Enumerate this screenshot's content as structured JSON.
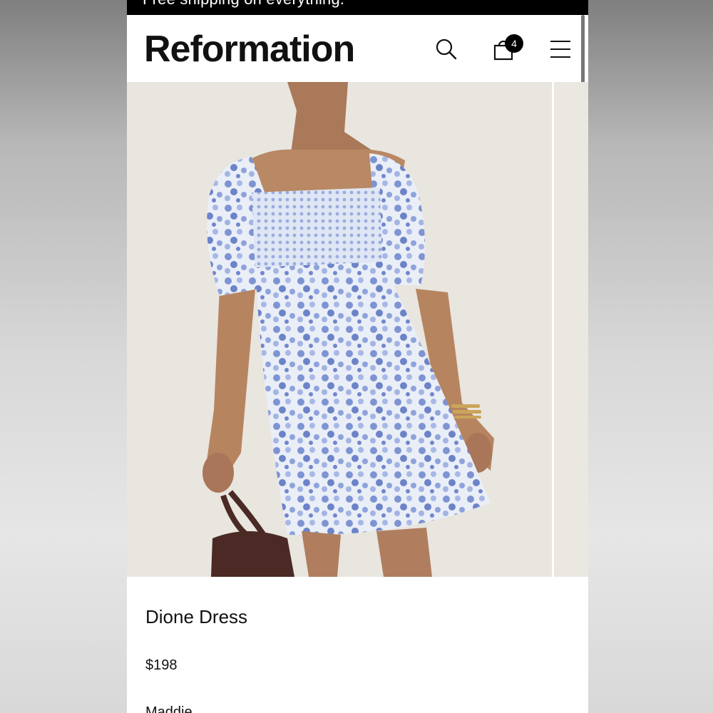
{
  "promo": {
    "text": "Free shipping on everything."
  },
  "header": {
    "logo": "Reformation",
    "search_icon": "search-icon",
    "bag_icon": "shopping-bag-icon",
    "bag_count": "4",
    "menu_icon": "hamburger-menu-icon"
  },
  "product": {
    "name": "Dione Dress",
    "price": "$198",
    "color": "Maddie"
  },
  "colors": {
    "brand": "#000000",
    "dress_blue": "#7c90cf",
    "background": "#ffffff"
  }
}
